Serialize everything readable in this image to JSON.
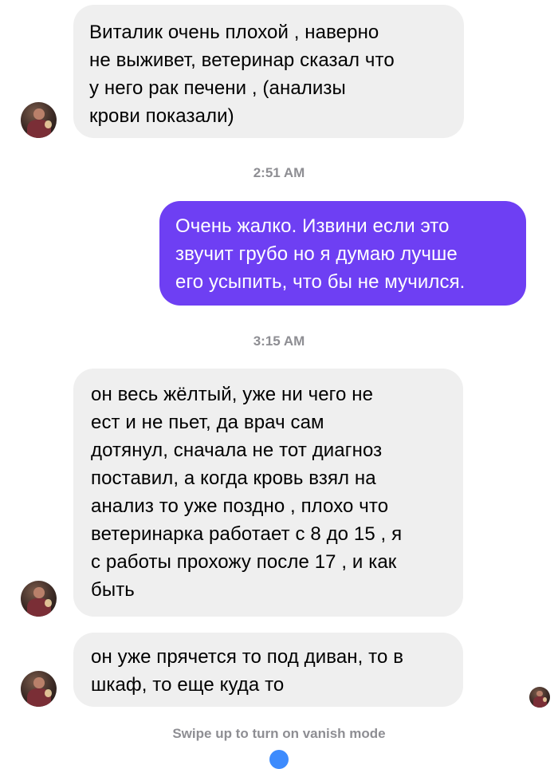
{
  "messages": [
    {
      "text": "Виталик очень плохой , наверно\nне выживет, ветеринар сказал что\nу него рак печени , (анализы\nкрови показали)"
    },
    {
      "text": "Очень жалко. Извини если это\nзвучит грубо но я думаю лучше\nего усыпить, что бы не мучился."
    },
    {
      "text": "он весь жёлтый, уже ни чего не\nест и не пьет, да врач сам\nдотянул, сначала не тот диагноз\nпоставил, а когда кровь взял на\nанализ то уже поздно , плохо что\nветеринарка  работает с 8 до 15 , я\nс работы прохожу после 17 , и как\nбыть"
    },
    {
      "text": "он уже прячется то под диван, то в\nшкаф, то еще куда то"
    }
  ],
  "timestamps": [
    "2:51 AM",
    "3:15 AM"
  ],
  "footer": {
    "vanish_text": "Swipe up to turn on vanish mode"
  },
  "colors": {
    "incoming_bubble": "#efefef",
    "outgoing_bubble": "#6e3ff3",
    "timestamp_text": "#8e8e93"
  },
  "icons": {
    "contact_avatar": "avatar-icon",
    "seen_avatar": "avatar-icon",
    "vanish_mode": "vanish-mode-icon"
  }
}
